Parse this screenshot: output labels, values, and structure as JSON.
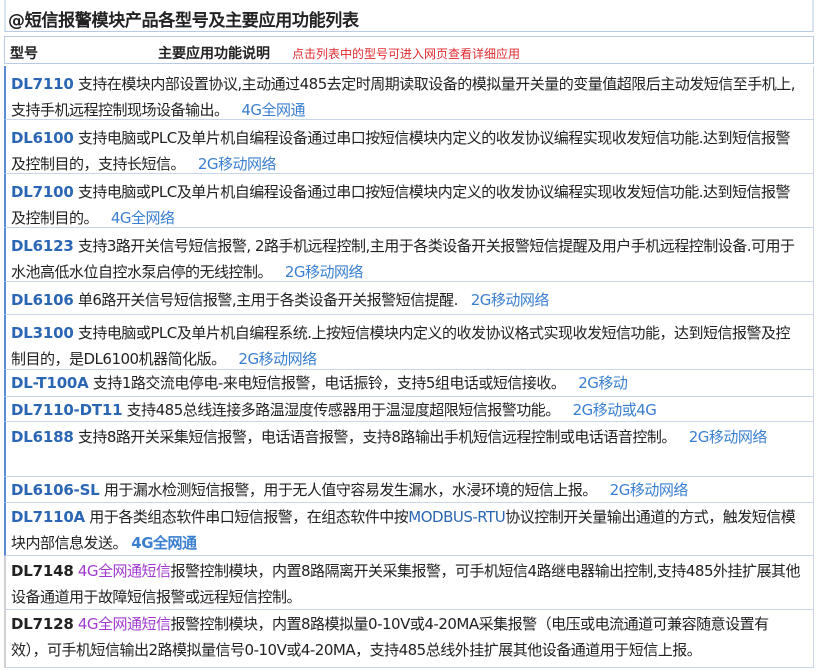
{
  "title": "@短信报警模块产品各型号及主要应用功能列表",
  "header": {
    "model_label": "型号",
    "function_label": "主要应用功能说明",
    "note": "点击列表中的型号可进入网页查看详细应用"
  },
  "rows": [
    {
      "model": "DL7110",
      "desc": "支持在模块内部设置协议,主动通过485去定时周期读取设备的模拟量开关量的变量值超限后主动发短信至手机上,支持手机远程控制现场设备输出。",
      "network": "4G全网通"
    },
    {
      "model": "DL6100",
      "desc": "支持电脑或PLC及单片机自编程设备通过串口按短信模块内定义的收发协议编程实现收发短信功能.达到短信报警及控制目的，支持长短信。",
      "network": "2G移动网络"
    },
    {
      "model": "DL7100",
      "desc": "支持电脑或PLC及单片机自编程设备通过串口按短信模块内定义的收发协议编程实现收发短信功能.达到短信报警及控制目的。",
      "network": "4G全网络"
    },
    {
      "model": "DL6123",
      "desc": "支持3路开关信号短信报警, 2路手机远程控制,主用于各类设备开关报警短信提醒及用户手机远程控制设备.可用于水池高低水位自控水泵启停的无线控制。",
      "network": "2G移动网络"
    },
    {
      "model": "DL6106",
      "desc": "单6路开关信号短信报警,主用于各类设备开关报警短信提醒.",
      "network": "2G移动网络"
    },
    {
      "model": "DL3100",
      "desc": "支持电脑或PLC及单片机自编程系统.上按短信模块内定义的收发协议格式实现收发短信功能，达到短信报警及控制目的，是DL6100机器简化版。",
      "network": "2G移动网络"
    },
    {
      "model": "DL-T100A",
      "desc": "支持1路交流电停电-来电短信报警，电话振铃，支持5组电话或短信接收。",
      "network": "2G移动"
    },
    {
      "model": "DL7110-DT11",
      "desc": "支持485总线连接多路温湿度传感器用于温湿度超限短信报警功能。",
      "network": "2G移动或4G"
    },
    {
      "model": "DL6188",
      "desc": "支持8路开关采集短信报警，电话语音报警，支持8路输出手机短信远程控制或电话语音控制。",
      "network": "2G移动网络"
    },
    {
      "model": "DL6106-SL",
      "desc": "用于漏水检测短信报警，用于无人值守容易发生漏水，水浸环境的短信上报。",
      "network": "2G移动网络"
    },
    {
      "model": "DL7110A",
      "desc_before": "用于各类组态软件串口短信报警，在组态软件中按",
      "protocol": "MODBUS-RTU",
      "desc_after": "协议控制开关量输出通道的方式，触发短信模块内部信息发送。",
      "network": "4G全网通"
    },
    {
      "model": "DL7148",
      "network": "4G全网通短信",
      "desc": "报警控制模块，内置8路隔离开关采集报警，可手机短信4路继电器输出控制,支持485外挂扩展其他设备通道用于故障短信报警或远程短信控制。"
    },
    {
      "model": "DL7128",
      "network": "4G全网通短信",
      "desc": "报警控制模块，内置8路模拟量0-10V或4-20MA采集报警（电压或电流通道可兼容随意设置有效），可手机短信输出2路模拟量信号0-10V或4-20MA，支持485总线外挂扩展其他设备通道用于短信上报。"
    }
  ]
}
